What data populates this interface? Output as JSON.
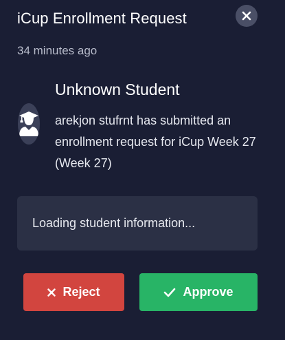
{
  "dialog": {
    "title": "iCup Enrollment Request",
    "timestamp": "34 minutes ago",
    "close_icon": "close-icon"
  },
  "student": {
    "name": "Unknown Student",
    "avatar_icon": "graduate-user-icon",
    "message": "arekjon stufrnt has submitted an enrollment request for iCup Week 27 (Week 27)"
  },
  "loading": {
    "text": "Loading student information..."
  },
  "actions": {
    "reject_label": "Reject",
    "reject_icon": "x-icon",
    "approve_label": "Approve",
    "approve_icon": "check-icon"
  },
  "colors": {
    "background": "#1a1e34",
    "card": "#2b3045",
    "reject": "#d2453f",
    "approve": "#28b466",
    "close_button": "#4a4f66"
  }
}
